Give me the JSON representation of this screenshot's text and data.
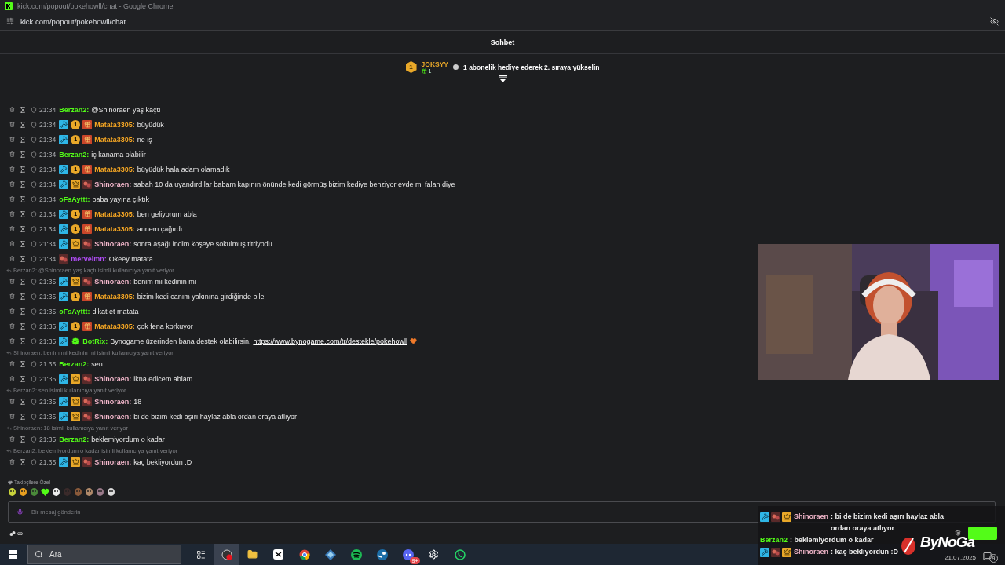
{
  "window": {
    "title": "kick.com/popout/pokehowll/chat - Google Chrome",
    "address": "kick.com/popout/pokehowll/chat"
  },
  "chat": {
    "title": "Sohbet",
    "pinned": {
      "rank": "1",
      "user": "JOKSYY",
      "count": "1",
      "message": "1 abonelik hediye ederek 2. sıraya yükselin"
    },
    "messages": [
      {
        "time": "21:34",
        "user": "Berzan2:",
        "color": "#53fc18",
        "text": "@Shinoraen yaş kaçtı"
      },
      {
        "time": "21:34",
        "badges": [
          {
            "kind": "mod"
          },
          {
            "kind": "coin",
            "label": "1"
          },
          {
            "kind": "gift"
          }
        ],
        "user": "Matata3305:",
        "color": "#f5a623",
        "text": "büyüdük"
      },
      {
        "time": "21:34",
        "badges": [
          {
            "kind": "mod"
          },
          {
            "kind": "coin",
            "label": "1"
          },
          {
            "kind": "gift"
          }
        ],
        "user": "Matata3305:",
        "color": "#f5a623",
        "text": "ne iş"
      },
      {
        "time": "21:34",
        "user": "Berzan2:",
        "color": "#53fc18",
        "text": "iç kanama olabilir"
      },
      {
        "time": "21:34",
        "badges": [
          {
            "kind": "mod"
          },
          {
            "kind": "coin",
            "label": "1"
          },
          {
            "kind": "gift"
          }
        ],
        "user": "Matata3305:",
        "color": "#f5a623",
        "text": "büyüdük hala adam olamadık"
      },
      {
        "time": "21:34",
        "badges": [
          {
            "kind": "mod"
          },
          {
            "kind": "crown"
          },
          {
            "kind": "emote"
          }
        ],
        "user": "Shinoraen:",
        "color": "#f4b8cc",
        "text": "sabah 10 da uyandırdılar babam kapının önünde kedi görmüş bizim kediye benziyor evde mi falan diye"
      },
      {
        "time": "21:34",
        "user": "oFsAyttt:",
        "color": "#53fc18",
        "text": "baba yayına çıktık"
      },
      {
        "time": "21:34",
        "badges": [
          {
            "kind": "mod"
          },
          {
            "kind": "coin",
            "label": "1"
          },
          {
            "kind": "gift"
          }
        ],
        "user": "Matata3305:",
        "color": "#f5a623",
        "text": "ben geliyorum abla"
      },
      {
        "time": "21:34",
        "badges": [
          {
            "kind": "mod"
          },
          {
            "kind": "coin",
            "label": "1"
          },
          {
            "kind": "gift"
          }
        ],
        "user": "Matata3305:",
        "color": "#f5a623",
        "text": "annem çağırdı"
      },
      {
        "time": "21:34",
        "badges": [
          {
            "kind": "mod"
          },
          {
            "kind": "crown"
          },
          {
            "kind": "emote"
          }
        ],
        "user": "Shinoraen:",
        "color": "#f4b8cc",
        "text": "sonra aşağı indim köşeye sokulmuş titriyodu"
      },
      {
        "time": "21:34",
        "badges": [
          {
            "kind": "emote"
          }
        ],
        "user": "mervelmn:",
        "color": "#b04cf5",
        "text": "Okeey matata"
      },
      {
        "reply": "Berzan2: @Shinoraen yaş kaçtı isimli kullanıcıya yanıt veriyor",
        "time": "21:35",
        "badges": [
          {
            "kind": "mod"
          },
          {
            "kind": "crown"
          },
          {
            "kind": "emote"
          }
        ],
        "user": "Shinoraen:",
        "color": "#f4b8cc",
        "text": "benim mi kedinin mi"
      },
      {
        "time": "21:35",
        "badges": [
          {
            "kind": "mod"
          },
          {
            "kind": "coin",
            "label": "1"
          },
          {
            "kind": "gift"
          }
        ],
        "user": "Matata3305:",
        "color": "#f5a623",
        "text": "bizim kedi canım yakınına girdiğinde bile"
      },
      {
        "time": "21:35",
        "user": "oFsAyttt:",
        "color": "#53fc18",
        "text": "dikat et matata"
      },
      {
        "time": "21:35",
        "badges": [
          {
            "kind": "mod"
          },
          {
            "kind": "coin",
            "label": "1"
          },
          {
            "kind": "gift"
          }
        ],
        "user": "Matata3305:",
        "color": "#f5a623",
        "text": "çok fena korkuyor"
      },
      {
        "time": "21:35",
        "badges": [
          {
            "kind": "mod"
          },
          {
            "kind": "verified"
          }
        ],
        "user": "BotRix:",
        "color": "#53fc18",
        "text": "Bynogame üzerinden bana destek olabilirsin.",
        "link": "https://www.bynogame.com/tr/destekle/pokehowll"
      },
      {
        "reply": "Shinoraen: benim mi kedinin mi isimli kullanıcıya yanıt veriyor",
        "time": "21:35",
        "user": "Berzan2:",
        "color": "#53fc18",
        "text": "sen"
      },
      {
        "time": "21:35",
        "badges": [
          {
            "kind": "mod"
          },
          {
            "kind": "crown"
          },
          {
            "kind": "emote"
          }
        ],
        "user": "Shinoraen:",
        "color": "#f4b8cc",
        "text": "ikna edicem ablam"
      },
      {
        "reply": "Berzan2: sen isimli kullanıcıya yanıt veriyor",
        "time": "21:35",
        "badges": [
          {
            "kind": "mod"
          },
          {
            "kind": "crown"
          },
          {
            "kind": "emote"
          }
        ],
        "user": "Shinoraen:",
        "color": "#f4b8cc",
        "text": "18"
      },
      {
        "time": "21:35",
        "badges": [
          {
            "kind": "mod"
          },
          {
            "kind": "crown"
          },
          {
            "kind": "emote"
          }
        ],
        "user": "Shinoraen:",
        "color": "#f4b8cc",
        "text": "bi de bizim kedi aşırı haylaz abla ordan oraya atlıyor"
      },
      {
        "reply": "Shinoraen: 18 isimli kullanıcıya yanıt veriyor",
        "time": "21:35",
        "user": "Berzan2:",
        "color": "#53fc18",
        "text": "beklemiyordum o kadar"
      },
      {
        "reply": "Berzan2: beklemiyordum o kadar isimli kullanıcıya yanıt veriyor",
        "time": "21:35",
        "badges": [
          {
            "kind": "mod"
          },
          {
            "kind": "crown"
          },
          {
            "kind": "emote"
          }
        ],
        "user": "Shinoraen:",
        "color": "#f4b8cc",
        "text": "kaç bekliyordun :D"
      }
    ],
    "emote_section": "Takipçilere Özel",
    "input": {
      "placeholder": "Bir mesaj gönderin"
    },
    "footer": "∞"
  },
  "overlay": {
    "messages": [
      {
        "badges": [
          {
            "kind": "mod"
          },
          {
            "kind": "emote"
          },
          {
            "kind": "crown"
          }
        ],
        "user": "Shinoraen",
        "color": "#f4b8cc",
        "text": " : bi de bizim kedi aşırı haylaz abla ordan oraya atlıyor"
      },
      {
        "user": "Berzan2",
        "color": "#53fc18",
        "text": " : beklemiyordum o kadar"
      },
      {
        "badges": [
          {
            "kind": "mod"
          },
          {
            "kind": "emote"
          },
          {
            "kind": "crown"
          }
        ],
        "user": "Shinoraen",
        "color": "#f4b8cc",
        "text": " : kaç bekliyordun :D"
      }
    ],
    "logo": "ByNoGa",
    "date": "21.07.2025",
    "notifications": "9"
  },
  "taskbar": {
    "search": "Ara",
    "discord_badge": "9+"
  }
}
